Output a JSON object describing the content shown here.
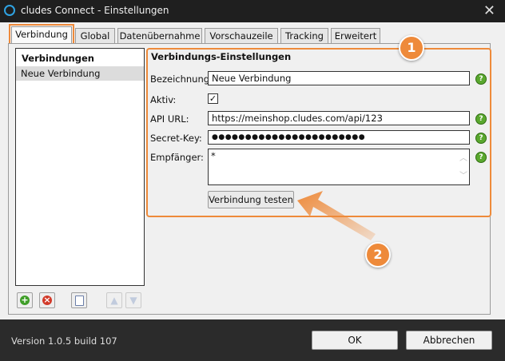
{
  "window": {
    "title": "cludes Connect - Einstellungen",
    "close_glyph": "✕"
  },
  "tabs": [
    {
      "label": "Verbindung",
      "active": true
    },
    {
      "label": "Global"
    },
    {
      "label": "Datenübernahme"
    },
    {
      "label": "Vorschauzeile"
    },
    {
      "label": "Tracking"
    },
    {
      "label": "Erweitert"
    }
  ],
  "connections": {
    "header": "Verbindungen",
    "items": [
      "Neue Verbindung"
    ]
  },
  "toolbar": {
    "add_icon": "add-icon",
    "remove_icon": "remove-icon",
    "copy_icon": "copy-icon",
    "up_icon": "move-up-icon",
    "down_icon": "move-down-icon"
  },
  "settings": {
    "heading": "Verbindungs-Einstellungen",
    "name_label": "Bezeichnung:",
    "name_value": "Neue Verbindung",
    "active_label": "Aktiv:",
    "active_checked": true,
    "api_label": "API URL:",
    "api_value": "https://meinshop.cludes.com/api/123",
    "secret_label": "Secret-Key:",
    "secret_value": "●●●●●●●●●●●●●●●●●●●●●●●",
    "recipients_label": "Empfänger:",
    "recipients_value": "*",
    "test_button": "Verbindung testen"
  },
  "annotations": [
    "1",
    "2"
  ],
  "footer": {
    "version": "Version 1.0.5 build 107",
    "ok": "OK",
    "cancel": "Abbrechen"
  },
  "colors": {
    "accent": "#ee8a3a",
    "help": "#5aa82e",
    "dark": "#2b2b2b"
  }
}
